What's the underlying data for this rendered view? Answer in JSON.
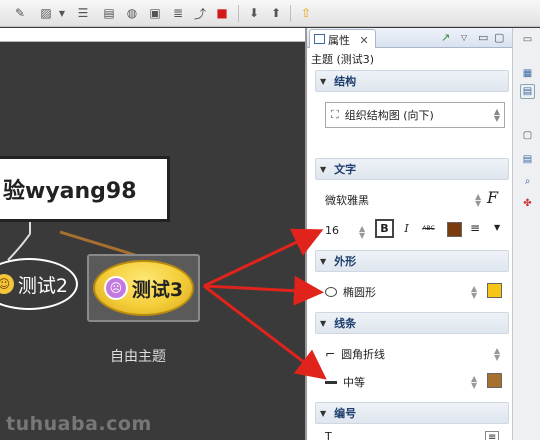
{
  "toolbar": {
    "icons": [
      "edit-icon",
      "image-icon",
      "dropdown-icon",
      "layout-icon",
      "note-icon",
      "globe-icon",
      "label-icon",
      "list-icon",
      "relationship-icon",
      "stop-icon",
      "drill-down-icon",
      "drill-up-icon",
      "home-icon"
    ]
  },
  "canvas": {
    "central_topic": "验wyang98",
    "topic2": "测试2",
    "topic3": "测试3",
    "free_topic": "自由主题",
    "watermark": "tuhuaba.com"
  },
  "panel": {
    "tab_label": "属性",
    "tab_close": "✕",
    "subject": "主题 (测试3)",
    "structure": {
      "title": "结构",
      "value": "组织结构图 (向下)"
    },
    "text": {
      "title": "文字",
      "font": "微软雅黑",
      "font_button": "F",
      "size": "16",
      "bold": "B",
      "italic": "I",
      "strike": "ABC",
      "color": "#7a3c0f"
    },
    "shape": {
      "title": "外形",
      "value": "椭圆形",
      "fill_color": "#f5c518"
    },
    "line": {
      "title": "线条",
      "style": "圆角折线",
      "width": "中等",
      "color": "#a8702f"
    },
    "numbering": {
      "title": "编号",
      "partial": "T"
    }
  },
  "annotation": {
    "arrow_color": "#e0231b"
  }
}
